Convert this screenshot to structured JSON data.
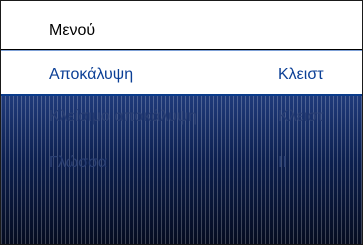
{
  "header": {
    "title": "Μενού"
  },
  "menu": {
    "items": [
      {
        "label": "Αποκάλυψη",
        "value": "Κλειστ"
      },
      {
        "label": "Κλείσιμο αποκάλυψη",
        "value": "Κλειστ"
      },
      {
        "label": "Γλώσσα",
        "value": "ΙΙ"
      }
    ]
  },
  "colors": {
    "selected_text": "#0b3f96",
    "panel_top": "#1f3a7a",
    "panel_bottom": "#050c20",
    "dimmed_text": "#2a3f73"
  }
}
